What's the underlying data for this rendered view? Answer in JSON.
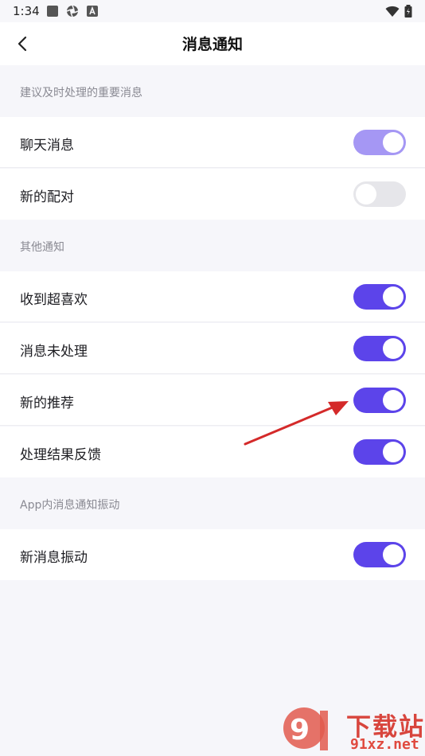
{
  "status_bar": {
    "time": "1:34"
  },
  "nav": {
    "title": "消息通知"
  },
  "sections": [
    {
      "header": "建议及时处理的重要消息",
      "items": [
        {
          "label": "聊天消息",
          "on": true,
          "style": "light"
        },
        {
          "label": "新的配对",
          "on": false
        }
      ]
    },
    {
      "header": "其他通知",
      "items": [
        {
          "label": "收到超喜欢",
          "on": true
        },
        {
          "label": "消息未处理",
          "on": true
        },
        {
          "label": "新的推荐",
          "on": true
        },
        {
          "label": "处理结果反馈",
          "on": true
        }
      ]
    },
    {
      "header": "App内消息通知振动",
      "items": [
        {
          "label": "新消息振动",
          "on": true
        }
      ]
    }
  ],
  "watermark": {
    "brand": "下载站",
    "domain": "91xz.net"
  },
  "colors": {
    "accent": "#5c44ea",
    "accent_light": "#a597f4",
    "off": "#e6e6ea"
  }
}
